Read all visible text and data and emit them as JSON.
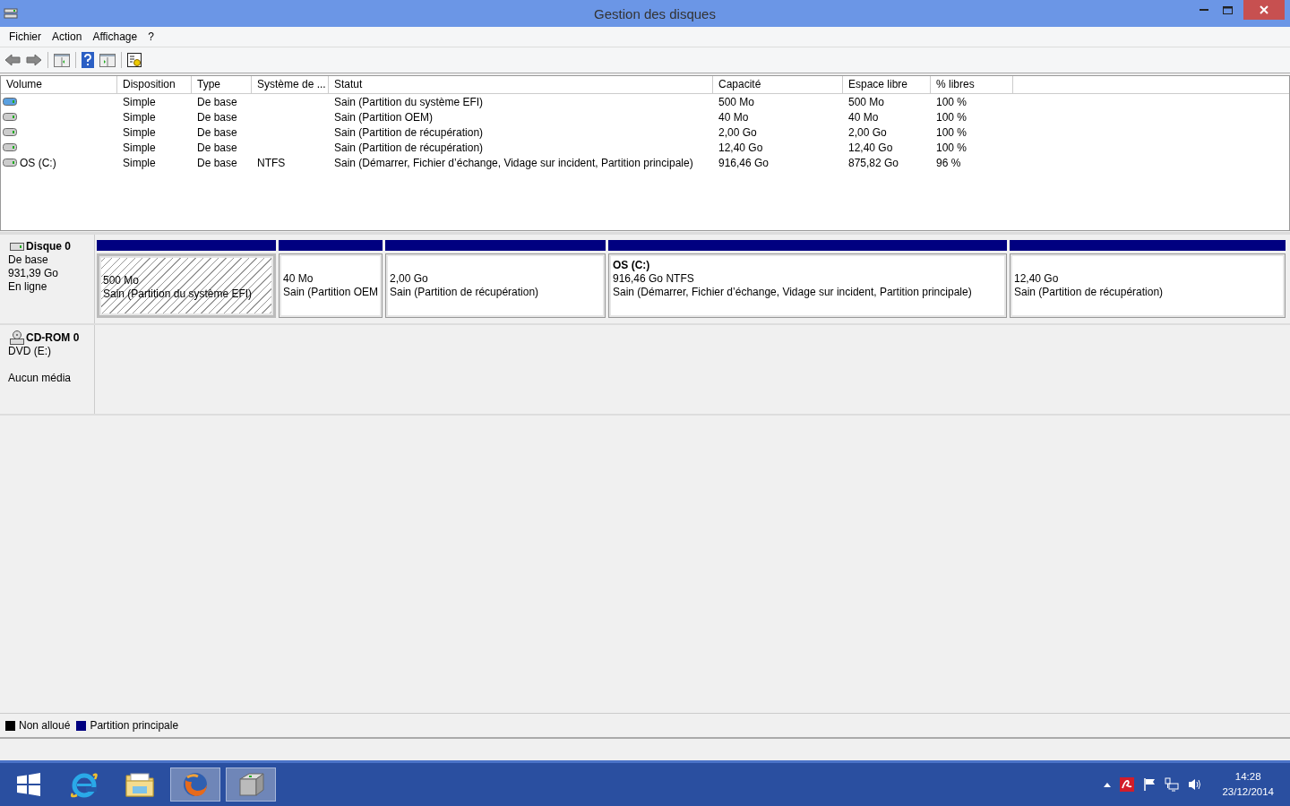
{
  "window": {
    "title": "Gestion des disques"
  },
  "menu": [
    "Fichier",
    "Action",
    "Affichage",
    "?"
  ],
  "table": {
    "columns": [
      "Volume",
      "Disposition",
      "Type",
      "Système de ...",
      "Statut",
      "Capacité",
      "Espace libre",
      "% libres"
    ],
    "rows": [
      {
        "selected": true,
        "layout": "Simple",
        "type": "De base",
        "status": "Sain (Partition du système EFI)",
        "capacity": "500 Mo",
        "free": "500 Mo",
        "pct": "100 %"
      },
      {
        "selected": false,
        "layout": "Simple",
        "type": "De base",
        "status": "Sain (Partition OEM)",
        "capacity": "40 Mo",
        "free": "40 Mo",
        "pct": "100 %"
      },
      {
        "selected": false,
        "layout": "Simple",
        "type": "De base",
        "status": "Sain (Partition de récupération)",
        "capacity": "2,00 Go",
        "free": "2,00 Go",
        "pct": "100 %"
      },
      {
        "selected": false,
        "layout": "Simple",
        "type": "De base",
        "status": "Sain (Partition de récupération)",
        "capacity": "12,40 Go",
        "free": "12,40 Go",
        "pct": "100 %"
      },
      {
        "selected": false,
        "volume": "OS (C:)",
        "layout": "Simple",
        "type": "De base",
        "filesystem": "NTFS",
        "status": "Sain (Démarrer, Fichier d’échange, Vidage sur incident, Partition principale)",
        "capacity": "916,46 Go",
        "free": "875,82 Go",
        "pct": "96 %"
      }
    ]
  },
  "disks": [
    {
      "kind": "disk",
      "name": "Disque 0",
      "lines": [
        "De base",
        "931,39 Go",
        "En ligne"
      ],
      "partitions": [
        {
          "selected": true,
          "size": "500 Mo",
          "status": "Sain (Partition du système EFI)"
        },
        {
          "selected": false,
          "size": "40 Mo",
          "status": "Sain (Partition OEM"
        },
        {
          "selected": false,
          "size": "2,00 Go",
          "status": "Sain (Partition de récupération)"
        },
        {
          "selected": false,
          "name": "OS  (C:)",
          "size": "916,46 Go NTFS",
          "status": "Sain (Démarrer, Fichier d’échange, Vidage sur incident, Partition principale)"
        },
        {
          "selected": false,
          "size": "12,40 Go",
          "status": "Sain (Partition de récupération)"
        }
      ]
    },
    {
      "kind": "cdrom",
      "name": "CD-ROM 0",
      "lines": [
        "DVD (E:)",
        "Aucun média"
      ]
    }
  ],
  "legend": [
    {
      "label": "Non alloué",
      "color": "#000000"
    },
    {
      "label": "Partition principale",
      "color": "#000080"
    }
  ],
  "taskbar": {
    "apps": [
      {
        "kind": "ie",
        "active": false
      },
      {
        "kind": "explorer",
        "active": false
      },
      {
        "kind": "firefox",
        "active": true
      },
      {
        "kind": "disk",
        "active": true
      }
    ],
    "time": "14:28",
    "date": "23/12/2014"
  }
}
